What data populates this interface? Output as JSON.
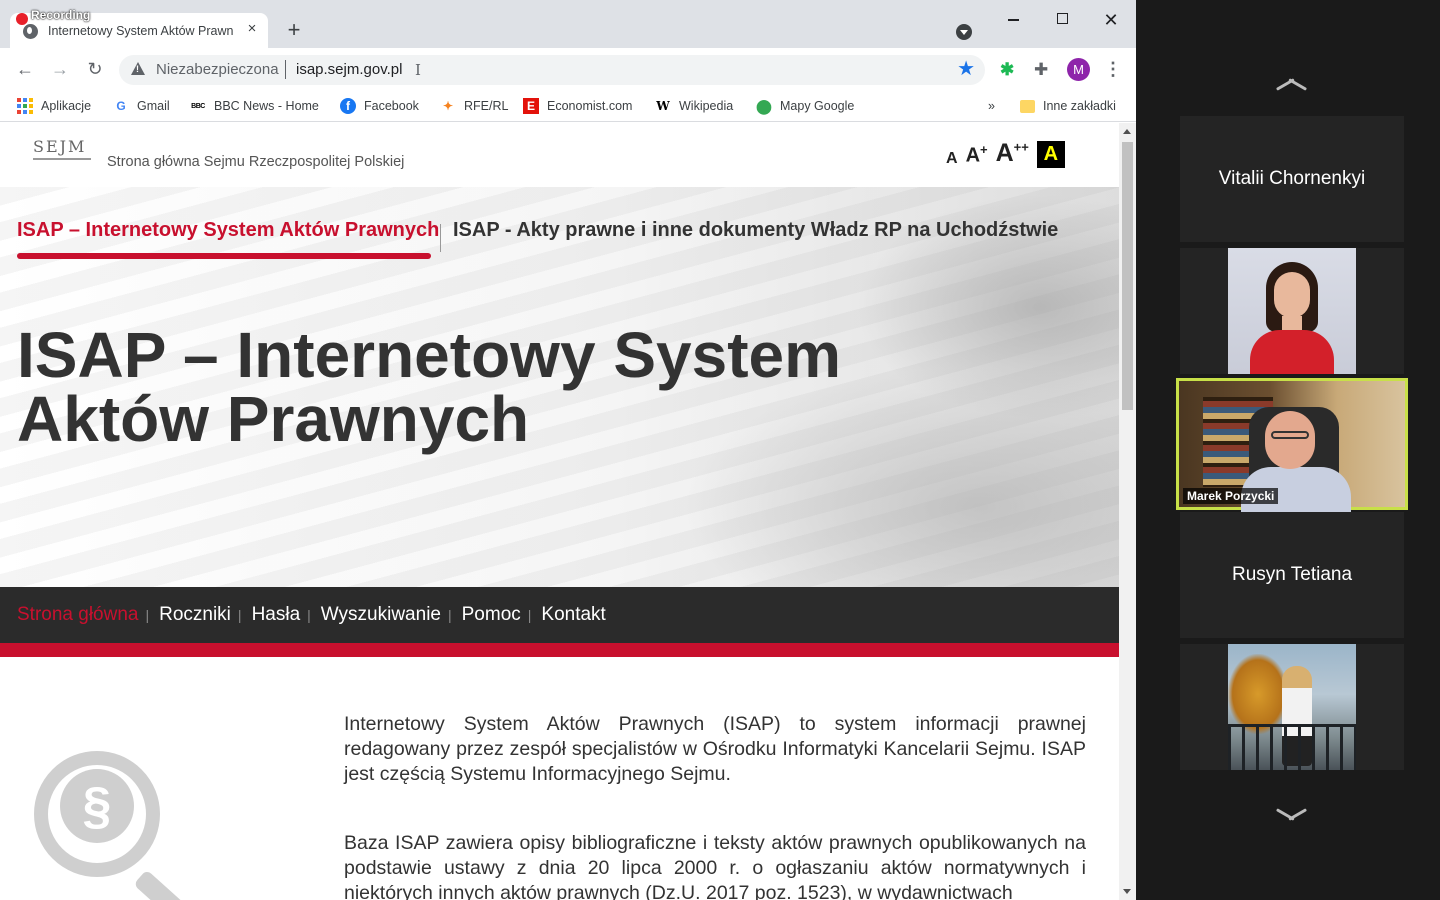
{
  "browser": {
    "recording_label": "Recording",
    "tab_title": "Internetowy System Aktów Prawn",
    "tab_close": "×",
    "new_tab": "+",
    "window_close": "✕",
    "omnibox": {
      "security_label": "Niezabezpieczona",
      "url": "isap.sejm.gov.pl",
      "cursor": "I"
    },
    "profile_initial": "M",
    "menu_glyph": "⋮",
    "bookmarks": {
      "items": [
        "Aplikacje",
        "Gmail",
        "BBC News - Home",
        "Facebook",
        "RFE/RL",
        "Economist.com",
        "Wikipedia",
        "Mapy Google"
      ],
      "overflow": "»",
      "other": "Inne zakładki"
    }
  },
  "site": {
    "logo_text": "SEJM",
    "header_title": "Strona główna Sejmu Rzeczpospolitej Polskiej",
    "font_controls": {
      "small": "A",
      "medium": "A",
      "medium_sup": "+",
      "large": "A",
      "large_sup": "++",
      "contrast": "A"
    },
    "hero": {
      "tab_active": "ISAP – Internetowy System Aktów Prawnych",
      "tab_other": "ISAP - Akty prawne i inne dokumenty Władz RP na Uchodźstwie",
      "title_line1": "ISAP – Internetowy System",
      "title_line2": "Aktów Prawnych"
    },
    "nav": {
      "items": [
        "Strona główna",
        "Roczniki",
        "Hasła",
        "Wyszukiwanie",
        "Pomoc",
        "Kontakt"
      ],
      "active_index": 0,
      "separator": "|"
    },
    "search_graphic_symbol": "§",
    "paragraphs": [
      "Internetowy System Aktów Prawnych (ISAP) to system informacji prawnej redagowany przez zespół specjalistów w Ośrodku Informatyki Kancelarii Sejmu. ISAP jest częścią Systemu Informacyjnego Sejmu.",
      "Baza ISAP zawiera opisy bibliograficzne i teksty aktów prawnych opublikowanych na podstawie ustawy z dnia 20 lipca 2000 r. o ogłaszaniu aktów normatywnych i niektórych innych aktów prawnych (Dz.U. 2017 poz. 1523), w wydawnictwach"
    ],
    "colors": {
      "accent_red": "#c8102e",
      "nav_bg": "#2b2b2b"
    }
  },
  "meeting": {
    "participants": [
      {
        "name": "Vitalii Chornenkyi",
        "video": false
      },
      {
        "name": "",
        "video": true
      },
      {
        "name": "Marek Porzycki",
        "video": true,
        "active_speaker": true
      },
      {
        "name": "Rusyn Tetiana",
        "video": false
      },
      {
        "name": "",
        "video": true
      }
    ],
    "highlight_color": "#c8e048"
  }
}
